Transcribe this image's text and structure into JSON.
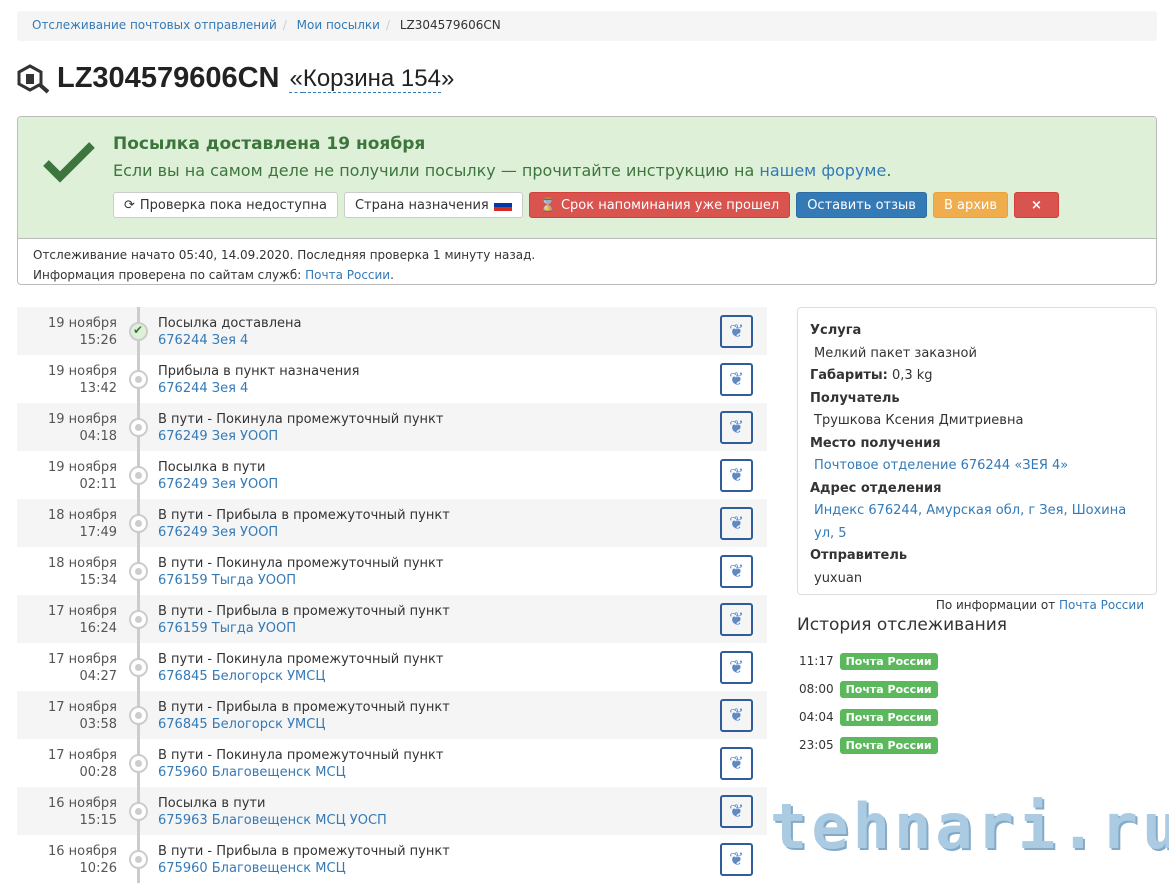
{
  "breadcrumb": [
    "Отслеживание почтовых отправлений",
    "Мои посылки",
    "LZ304579606CN"
  ],
  "title": {
    "track": "LZ304579606CN",
    "name": "Корзина 154",
    "quote_open": "«",
    "quote_close": "»"
  },
  "alert": {
    "heading": "Посылка доставлена 19 ноября",
    "msg": "Если вы на самом деле не получили посылку — прочитайте инструкцию на ",
    "msg_link": "нашем форуме",
    "msg_end": ".",
    "buttons": {
      "check": "Проверка пока недоступна",
      "country": "Страна назначения",
      "reminder": "Срок напоминания уже прошел",
      "review": "Оставить отзыв",
      "archive": "В архив",
      "close": "×"
    },
    "info1": "Отслеживание начато 05:40, 14.09.2020. Последняя проверка 1 минуту назад.",
    "info2": "Информация проверена по сайтам служб: ",
    "info2_link": "Почта России",
    "info2_end": "."
  },
  "events": [
    {
      "date": "19 ноября",
      "time": "15:26",
      "status": "Посылка доставлена",
      "place": "676244 Зея 4",
      "done": true
    },
    {
      "date": "19 ноября",
      "time": "13:42",
      "status": "Прибыла в пункт назначения",
      "place": "676244 Зея 4"
    },
    {
      "date": "19 ноября",
      "time": "04:18",
      "status": "В пути - Покинула промежуточный пункт",
      "place": "676249 Зея УООП"
    },
    {
      "date": "19 ноября",
      "time": "02:11",
      "status": "Посылка в пути",
      "place": "676249 Зея УООП"
    },
    {
      "date": "18 ноября",
      "time": "17:49",
      "status": "В пути - Прибыла в промежуточный пункт",
      "place": "676249 Зея УООП"
    },
    {
      "date": "18 ноября",
      "time": "15:34",
      "status": "В пути - Покинула промежуточный пункт",
      "place": "676159 Тыгда УООП"
    },
    {
      "date": "17 ноября",
      "time": "16:24",
      "status": "В пути - Прибыла в промежуточный пункт",
      "place": "676159 Тыгда УООП"
    },
    {
      "date": "17 ноября",
      "time": "04:27",
      "status": "В пути - Покинула промежуточный пункт",
      "place": "676845 Белогорск УМСЦ"
    },
    {
      "date": "17 ноября",
      "time": "03:58",
      "status": "В пути - Прибыла в промежуточный пункт",
      "place": "676845 Белогорск УМСЦ"
    },
    {
      "date": "17 ноября",
      "time": "00:28",
      "status": "В пути - Покинула промежуточный пункт",
      "place": "675960 Благовещенск МСЦ"
    },
    {
      "date": "16 ноября",
      "time": "15:15",
      "status": "Посылка в пути",
      "place": "675963 Благовещенск МСЦ УОСП"
    },
    {
      "date": "16 ноября",
      "time": "10:26",
      "status": "В пути - Прибыла в промежуточный пункт",
      "place": "675960 Благовещенск МСЦ"
    }
  ],
  "details": {
    "service_label": "Услуга",
    "service": "Мелкий пакет заказной",
    "size_label": "Габариты:",
    "size": "0,3 kg",
    "recipient_label": "Получатель",
    "recipient": "Трушкова Ксения Дмитриевна",
    "place_label": "Место получения",
    "place": "Почтовое отделение 676244 «ЗЕЯ 4»",
    "address_label": "Адрес отделения",
    "address": "Индекс 676244, Амурская обл, г Зея, Шохина ул, 5",
    "sender_label": "Отправитель",
    "sender": "yuxuan",
    "footer": "По информации от ",
    "footer_link": "Почта России"
  },
  "history": {
    "title": "История отслеживания",
    "items": [
      {
        "time": "11:17",
        "service": "Почта России"
      },
      {
        "time": "08:00",
        "service": "Почта России"
      },
      {
        "time": "04:04",
        "service": "Почта России"
      },
      {
        "time": "23:05",
        "service": "Почта России"
      }
    ]
  },
  "watermark": "tehnari.ru"
}
